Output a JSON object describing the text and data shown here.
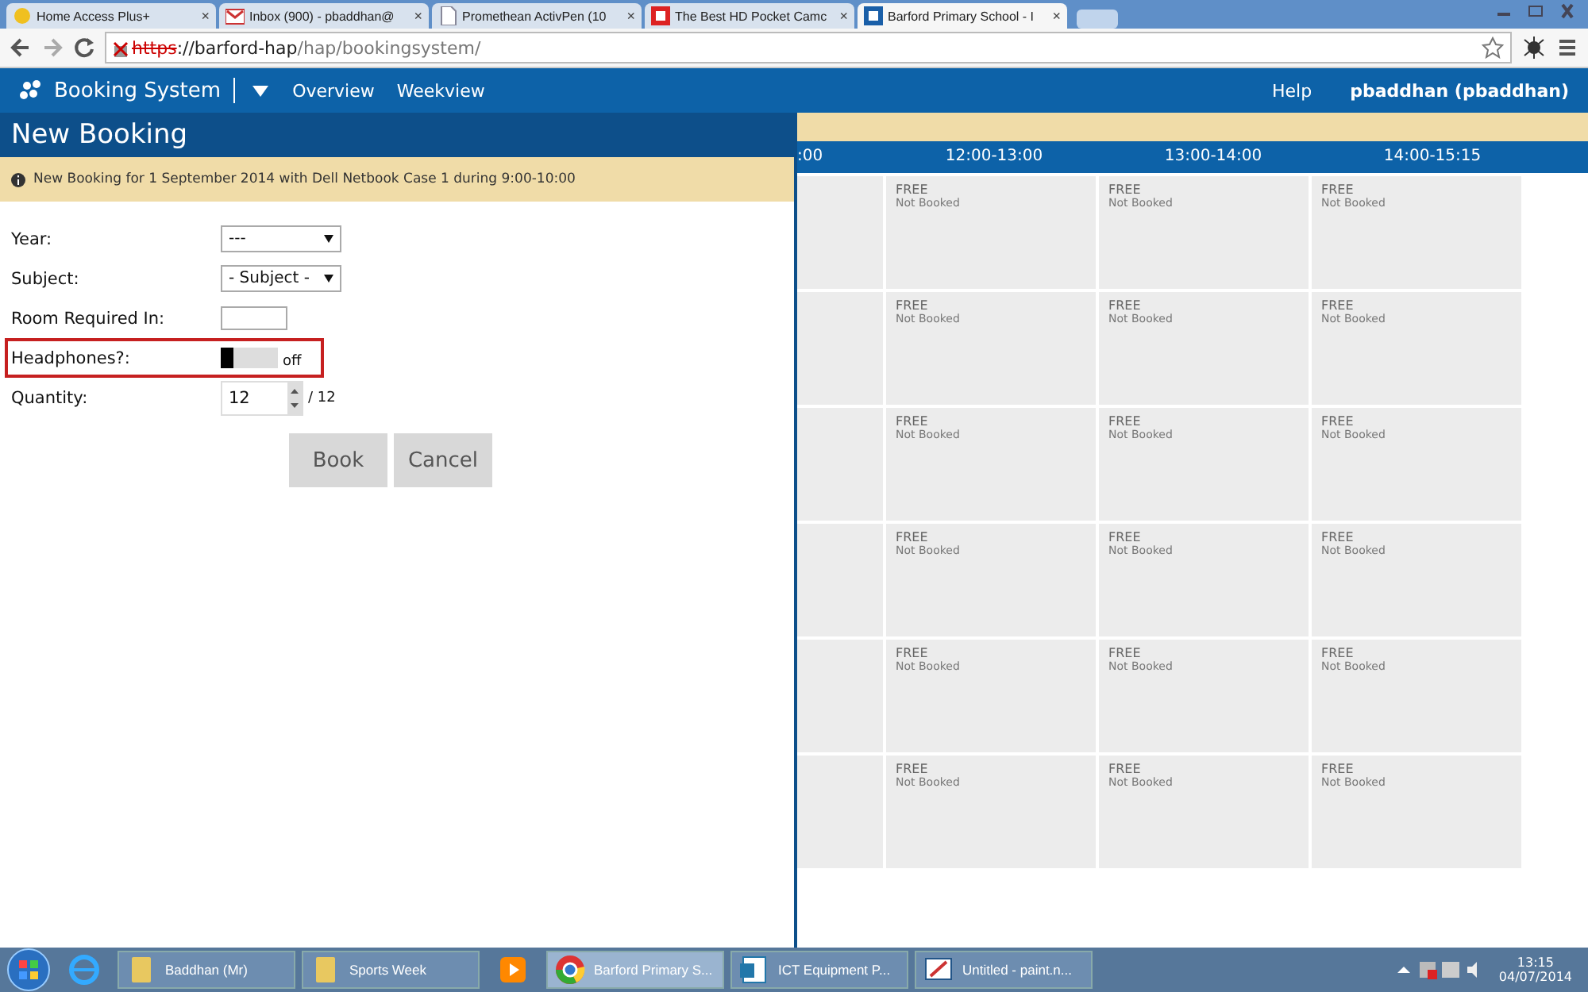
{
  "browser": {
    "tabs": [
      {
        "label": "Home Access Plus+",
        "close": "×",
        "selected": false
      },
      {
        "label": "Inbox (900) - pbaddhan@",
        "close": "×",
        "selected": false
      },
      {
        "label": "Promethean ActivPen (10",
        "close": "×",
        "selected": false
      },
      {
        "label": "The Best HD Pocket Camc",
        "close": "×",
        "selected": false
      },
      {
        "label": "Barford Primary School - I",
        "close": "×",
        "selected": true
      }
    ],
    "address": {
      "scheme": "https",
      "host": "://barford-hap",
      "path": "/hap/bookingsystem/"
    }
  },
  "nav": {
    "title": "Booking System",
    "items": [
      "Overview",
      "Weekview"
    ],
    "help": "Help",
    "user": "pbaddhan (pbaddhan)"
  },
  "form": {
    "title": "New Booking",
    "notice": "New Booking for 1 September 2014 with Dell Netbook Case 1 during 9:00-10:00",
    "fields": [
      {
        "kind": "select",
        "label": "Year:",
        "value": "---"
      },
      {
        "kind": "select",
        "label": "Subject:",
        "value": "- Subject -"
      },
      {
        "kind": "text",
        "label": "Room Required In:"
      },
      {
        "kind": "toggle",
        "label": "Headphones?:",
        "on": false,
        "state_text": "off",
        "highlighted": true
      },
      {
        "kind": "number",
        "label": "Quantity:",
        "value": "12",
        "max": "/ 12"
      }
    ],
    "buttons": [
      "Book",
      "Cancel"
    ]
  },
  "grid": {
    "columns": [
      ":00",
      "12:00-13:00",
      "13:00-14:00",
      "14:00-15:15"
    ],
    "rows": [
      [
        {
          "status": "FREE",
          "note": "Not Booked"
        },
        {
          "status": "FREE",
          "note": "Not Booked"
        },
        {
          "status": "FREE",
          "note": "Not Booked"
        }
      ],
      [
        {
          "status": "FREE",
          "note": "Not Booked"
        },
        {
          "status": "FREE",
          "note": "Not Booked"
        },
        {
          "status": "FREE",
          "note": "Not Booked"
        }
      ],
      [
        {
          "status": "FREE",
          "note": "Not Booked"
        },
        {
          "status": "FREE",
          "note": "Not Booked"
        },
        {
          "status": "FREE",
          "note": "Not Booked"
        }
      ],
      [
        {
          "status": "FREE",
          "note": "Not Booked"
        },
        {
          "status": "FREE",
          "note": "Not Booked"
        },
        {
          "status": "FREE",
          "note": "Not Booked"
        }
      ],
      [
        {
          "status": "FREE",
          "note": "Not Booked"
        },
        {
          "status": "FREE",
          "note": "Not Booked"
        },
        {
          "status": "FREE",
          "note": "Not Booked"
        }
      ],
      [
        {
          "status": "FREE",
          "note": "Not Booked"
        },
        {
          "status": "FREE",
          "note": "Not Booked"
        },
        {
          "status": "FREE",
          "note": "Not Booked"
        }
      ]
    ]
  },
  "taskbar": {
    "items": [
      {
        "kind": "pinned"
      },
      {
        "kind": "window",
        "label": "Baddhan (Mr)",
        "selected": false
      },
      {
        "kind": "window",
        "label": "Sports Week",
        "selected": false
      },
      {
        "kind": "pinned"
      },
      {
        "kind": "window",
        "label": "Barford Primary S...",
        "selected": true
      },
      {
        "kind": "window",
        "label": "ICT Equipment P...",
        "selected": false
      },
      {
        "kind": "window",
        "label": "Untitled - paint.n...",
        "selected": false
      }
    ],
    "time": "13:15",
    "date": "04/07/2014"
  }
}
